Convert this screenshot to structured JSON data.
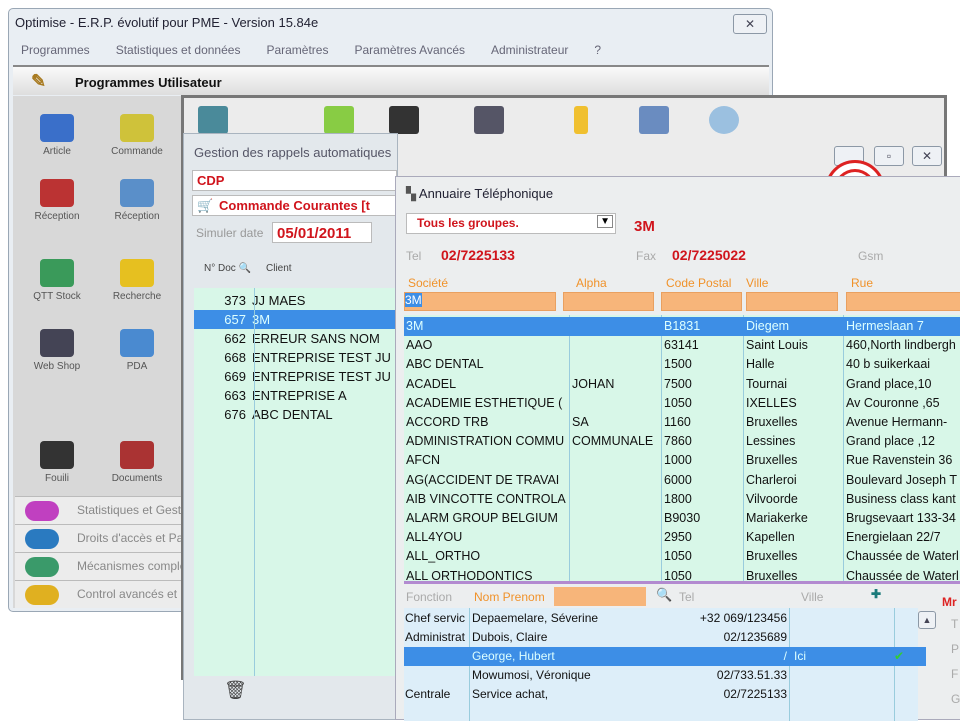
{
  "main": {
    "title": "Optimise - E.R.P. évolutif pour PME - Version 15.84e",
    "close": "✕",
    "menu": [
      "Programmes",
      "Statistiques et données",
      "Paramètres",
      "Paramètres Avancés",
      "Administrateur",
      "?"
    ],
    "section_title": "Programmes Utilisateur",
    "tiles": [
      {
        "label": "Article",
        "color": "#3a6fc9"
      },
      {
        "label": "Commande",
        "color": "#cfc23a"
      },
      {
        "label": "Réception",
        "color": "#b33"
      },
      {
        "label": "Réception",
        "color": "#5a8fc9"
      },
      {
        "label": "QTT Stock",
        "color": "#3a9a5a"
      },
      {
        "label": "Recherche",
        "color": "#e6c020"
      },
      {
        "label": "Web Shop",
        "color": "#445"
      },
      {
        "label": "PDA",
        "color": "#4a8ad0"
      },
      {
        "label": "Fouili",
        "color": "#333"
      },
      {
        "label": "Documents",
        "color": "#a33"
      }
    ],
    "sections": [
      {
        "label": "Statistiques et Gestion",
        "color": "#c040c0"
      },
      {
        "label": "Droits d'accès et Paramètres",
        "color": "#2a7ac0"
      },
      {
        "label": "Mécanismes complémentaires",
        "color": "#3a9a6a"
      },
      {
        "label": "Control avancés et",
        "color": "#e0b020"
      }
    ]
  },
  "gestion": {
    "title": "Gestion des rappels automatiques",
    "combo1": "CDP",
    "combo2": "Commande Courantes [t",
    "simuler_label": "Simuler date",
    "date": "05/01/2011",
    "col_doc": "N° Doc",
    "col_client": "Client",
    "rows": [
      {
        "doc": "373",
        "client": "JJ MAES"
      },
      {
        "doc": "657",
        "client": "3M",
        "selected": true
      },
      {
        "doc": "662",
        "client": "ERREUR SANS NOM"
      },
      {
        "doc": "668",
        "client": "ENTREPRISE TEST JU"
      },
      {
        "doc": "669",
        "client": "ENTREPRISE TEST JU"
      },
      {
        "doc": "663",
        "client": "ENTREPRISE A"
      },
      {
        "doc": "676",
        "client": "ABC DENTAL"
      }
    ]
  },
  "annuaire": {
    "title": "Annuaire Téléphonique",
    "group": "Tous les groupes.",
    "company": "3M",
    "tel_label": "Tel",
    "tel": "02/7225133",
    "fax_label": "Fax",
    "fax": "02/7225022",
    "gsm_label": "Gsm",
    "columns": [
      "Société",
      "Alpha",
      "Code Postal",
      "Ville",
      "Rue"
    ],
    "filter": "3M",
    "rows": [
      [
        "3M",
        "",
        "B1831",
        "Diegem",
        "Hermeslaan 7"
      ],
      [
        "AAO",
        "",
        "63141",
        "Saint Louis",
        "460,North lindbergh"
      ],
      [
        "ABC DENTAL",
        "",
        "1500",
        "Halle",
        "40 b suikerkaai"
      ],
      [
        "ACADEL",
        "JOHAN",
        "7500",
        "Tournai",
        "Grand place,10"
      ],
      [
        "ACADEMIE ESTHETIQUE (",
        "",
        "1050",
        "IXELLES",
        "Av Couronne ,65"
      ],
      [
        "ACCORD TRB",
        "SA",
        "1160",
        "Bruxelles",
        "Avenue Hermann-"
      ],
      [
        "ADMINISTRATION COMMU",
        "COMMUNALE",
        "7860",
        "Lessines",
        "Grand place ,12"
      ],
      [
        "AFCN",
        "",
        "1000",
        "Bruxelles",
        "Rue Ravenstein 36"
      ],
      [
        "AG(ACCIDENT DE TRAVAI",
        "",
        "6000",
        "Charleroi",
        "Boulevard Joseph T"
      ],
      [
        "AIB VINCOTTE CONTROLA",
        "",
        "1800",
        "Vilvoorde",
        "Business class kant"
      ],
      [
        "ALARM GROUP BELGIUM",
        "",
        "B9030",
        "Mariakerke",
        "Brugsevaart 133-34"
      ],
      [
        "ALL4YOU",
        "",
        "2950",
        "Kapellen",
        "Energielaan 22/7"
      ],
      [
        "ALL_ORTHO",
        "",
        "1050",
        "Bruxelles",
        "Chaussée de Waterl"
      ],
      [
        "ALL ORTHODONTICS",
        "",
        "1050",
        "Bruxelles",
        "Chaussée de Waterl"
      ]
    ],
    "contact_cols": {
      "fonction": "Fonction",
      "nom": "Nom Prenom",
      "tel": "Tel",
      "ville": "Ville"
    },
    "contacts": [
      [
        "Chef servic",
        "Depaemelare, Séverine",
        "+32 069/123456",
        "",
        ""
      ],
      [
        "Administrat",
        "Dubois, Claire",
        "02/1235689",
        "",
        ""
      ],
      [
        "",
        "George, Hubert",
        "/",
        "Ici",
        "✔"
      ],
      [
        "",
        "Mowumosi, Véronique",
        "02/733.51.33",
        "",
        ""
      ],
      [
        "Centrale",
        "Service achat,",
        "02/7225133",
        "",
        ""
      ]
    ],
    "right_letters": [
      "Mr",
      "T",
      "P",
      "F",
      "G"
    ]
  }
}
